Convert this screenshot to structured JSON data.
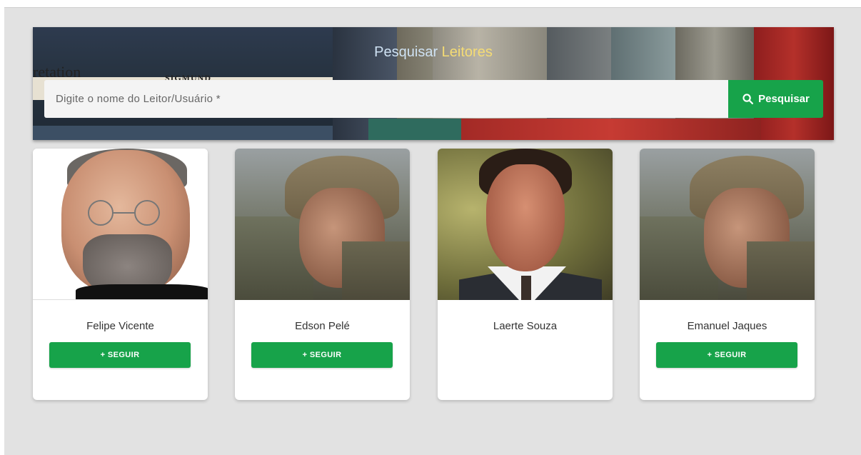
{
  "hero": {
    "title_prefix": "Pesquisar",
    "title_accent": "Leitores",
    "book_spine_1": "retation",
    "book_spine_2": "SIGMUND"
  },
  "search": {
    "placeholder": "Digite o nome do Leitor/Usuário *",
    "value": "",
    "button_label": "Pesquisar",
    "button_icon": "search-icon"
  },
  "colors": {
    "primary_green": "#17a34a",
    "accent_yellow": "#f5dc74",
    "page_bg": "#e2e2e2"
  },
  "readers": [
    {
      "name": "Felipe Vicente",
      "follow_label": "+ SEGUIR",
      "show_follow": true
    },
    {
      "name": "Edson Pelé",
      "follow_label": "+ SEGUIR",
      "show_follow": true
    },
    {
      "name": "Laerte Souza",
      "follow_label": "",
      "show_follow": false
    },
    {
      "name": "Emanuel Jaques",
      "follow_label": "+ SEGUIR",
      "show_follow": true
    }
  ]
}
